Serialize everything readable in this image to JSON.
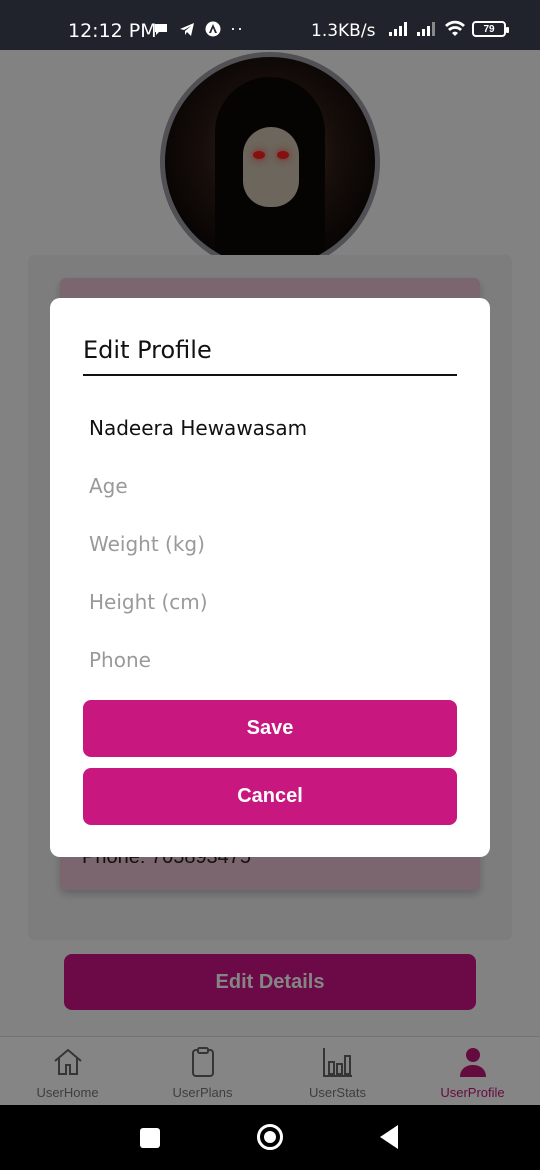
{
  "status_bar": {
    "time": "12:12 PM",
    "dots": "··",
    "speed": "1.3KB/s",
    "battery": "79"
  },
  "background": {
    "phone_text": "Phone: 705893475",
    "edit_details_label": "Edit Details"
  },
  "dialog": {
    "title": "Edit Profile",
    "name_value": "Nadeera Hewawasam",
    "age_placeholder": "Age",
    "weight_placeholder": "Weight (kg)",
    "height_placeholder": "Height (cm)",
    "phone_placeholder": "Phone",
    "save_label": "Save",
    "cancel_label": "Cancel",
    "accent_color": "#c8177f"
  },
  "bottom_nav": {
    "items": [
      {
        "label": "UserHome",
        "icon": "home-icon"
      },
      {
        "label": "UserPlans",
        "icon": "clipboard-icon"
      },
      {
        "label": "UserStats",
        "icon": "bar-chart-icon"
      },
      {
        "label": "UserProfile",
        "icon": "user-icon"
      }
    ],
    "active_color": "#c2187a"
  }
}
